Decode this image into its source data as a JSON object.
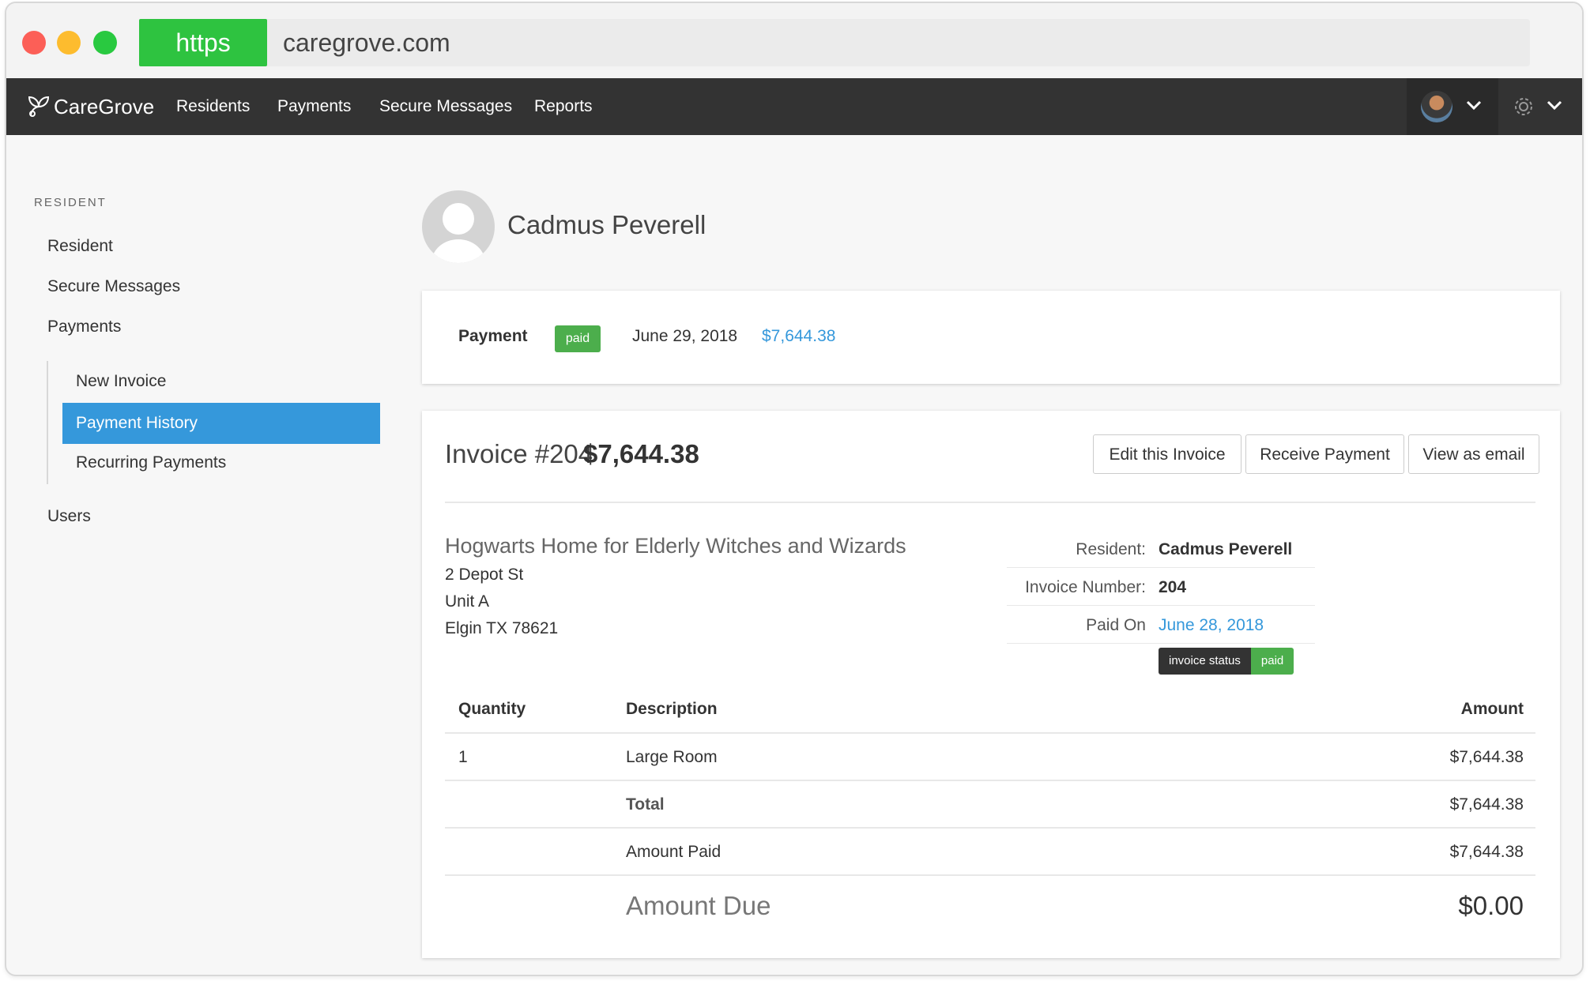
{
  "browser": {
    "https_label": "https",
    "url": "caregrove.com"
  },
  "navbar": {
    "brand": "CareGrove",
    "links": [
      "Residents",
      "Payments",
      "Secure Messages",
      "Reports"
    ]
  },
  "sidebar": {
    "section_label": "RESIDENT",
    "items": [
      "Resident",
      "Secure Messages",
      "Payments"
    ],
    "payments_sub": [
      "New Invoice",
      "Payment History",
      "Recurring Payments"
    ],
    "active_sub": "Payment History",
    "users": "Users"
  },
  "resident": {
    "name": "Cadmus Peverell"
  },
  "payment": {
    "label": "Payment",
    "status": "paid",
    "date": "June 29, 2018",
    "amount": "$7,644.38"
  },
  "invoice": {
    "title": "Invoice #204",
    "total": "$7,644.38",
    "buttons": {
      "edit": "Edit this Invoice",
      "receive": "Receive Payment",
      "email": "View as email"
    },
    "org": {
      "name": "Hogwarts Home for Elderly Witches and Wizards",
      "address": [
        "2 Depot St",
        "Unit A",
        "Elgin TX 78621"
      ]
    },
    "meta": {
      "resident_key": "Resident:",
      "resident_val": "Cadmus Peverell",
      "number_key": "Invoice Number:",
      "number_val": "204",
      "paid_key": "Paid On",
      "paid_val": "June 28, 2018",
      "status_key": "invoice status",
      "status_val": "paid"
    },
    "table": {
      "headers": [
        "Quantity",
        "Description",
        "Amount"
      ],
      "rows": [
        {
          "quantity": "1",
          "description": "Large Room",
          "amount": "$7,644.38"
        }
      ],
      "total_label": "Total",
      "total_amount": "$7,644.38",
      "paid_label": "Amount Paid",
      "paid_amount": "$7,644.38",
      "due_label": "Amount Due",
      "due_amount": "$0.00"
    }
  },
  "colors": {
    "accent": "#3598db",
    "success": "#4cae4c",
    "navbar": "#333333",
    "https": "#2ec340"
  }
}
